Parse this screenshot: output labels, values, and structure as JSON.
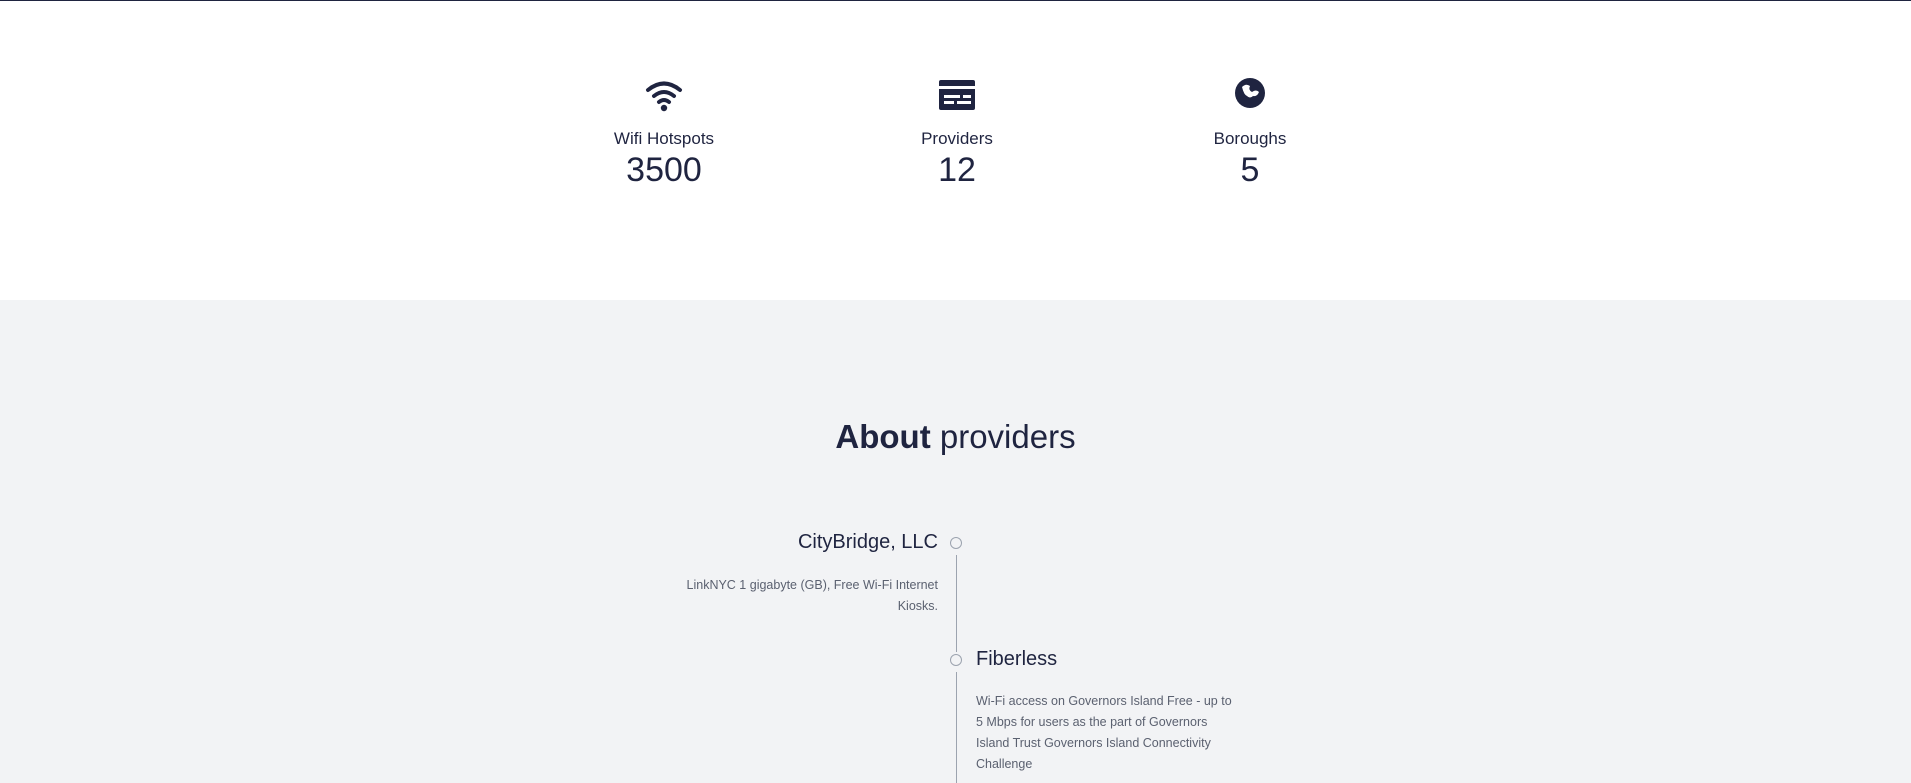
{
  "stats": [
    {
      "icon": "wifi-icon",
      "label": "Wifi Hotspots",
      "value": "3500"
    },
    {
      "icon": "credit-card-icon",
      "label": "Providers",
      "value": "12"
    },
    {
      "icon": "globe-icon",
      "label": "Boroughs",
      "value": "5"
    }
  ],
  "about": {
    "title_bold": "About",
    "title_light": "providers"
  },
  "providers": [
    {
      "name": "CityBridge, LLC",
      "description": "LinkNYC 1 gigabyte (GB), Free Wi-Fi Internet Kiosks."
    },
    {
      "name": "Fiberless",
      "description": "Wi-Fi access on Governors Island Free - up to 5 Mbps for users as the part of Governors Island Trust Governors Island Connectivity Challenge"
    }
  ],
  "colors": {
    "text": "#1f2440",
    "muted": "#5b6170",
    "gray_background": "#f2f3f5",
    "timeline": "#9ca3af"
  }
}
